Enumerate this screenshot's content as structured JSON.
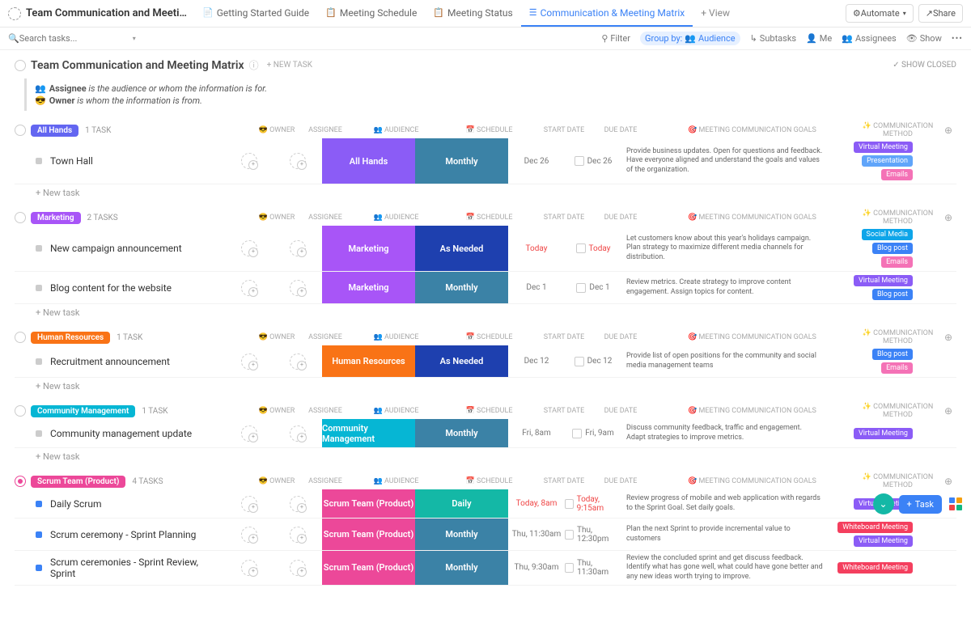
{
  "topbar": {
    "title": "Team Communication and Meeting Ma...",
    "tabs": [
      {
        "label": "Getting Started Guide",
        "icon": "📄"
      },
      {
        "label": "Meeting Schedule",
        "icon": "📋"
      },
      {
        "label": "Meeting Status",
        "icon": "📋"
      },
      {
        "label": "Communication & Meeting Matrix",
        "icon": "☰",
        "active": true
      }
    ],
    "add_view": "+ View",
    "automate": "Automate",
    "share": "Share"
  },
  "toolbar": {
    "search_placeholder": "Search tasks...",
    "filter": "Filter",
    "group_by": "Group by:",
    "group_by_value": "Audience",
    "subtasks": "Subtasks",
    "me": "Me",
    "assignees": "Assignees",
    "show": "Show"
  },
  "pagehead": {
    "title": "Team Communication and Meeting Matrix",
    "new_task": "+ NEW TASK",
    "show_closed": "✓ SHOW CLOSED"
  },
  "infobox": {
    "line1_bold": "Assignee",
    "line1_rest": "is the audience or whom the information is for.",
    "line2_bold": "Owner",
    "line2_rest": "is whom the information is from."
  },
  "column_headers": {
    "owner": "OWNER",
    "assignee": "ASSIGNEE",
    "audience": "AUDIENCE",
    "schedule": "SCHEDULE",
    "start": "START DATE",
    "due": "DUE DATE",
    "goals": "MEETING COMMUNICATION GOALS",
    "method": "COMMUNICATION METHOD"
  },
  "new_task_label": "+ New task",
  "colors": {
    "audience_allhands": "#8b5cf6",
    "audience_marketing": "#a855f7",
    "audience_hr": "#f97316",
    "audience_cm": "#06b6d4",
    "audience_scrum": "#ec4899",
    "schedule_monthly": "#3b82a6",
    "schedule_asneeded": "#1e40af",
    "schedule_daily": "#14b8a6",
    "tag_virtual": "#8b5cf6",
    "tag_presentation": "#60a5fa",
    "tag_emails": "#f472b6",
    "tag_social": "#0ea5e9",
    "tag_blogpost": "#3b82f6",
    "tag_whiteboard": "#f43f5e",
    "pill_allhands": "#6366f1",
    "pill_marketing": "#a855f7",
    "pill_hr": "#f97316",
    "pill_cm": "#06b6d4",
    "pill_scrum": "#ec4899"
  },
  "groups": [
    {
      "name": "All Hands",
      "pill_color": "pill_allhands",
      "count": "1 TASK",
      "tasks": [
        {
          "name": "Town Hall",
          "audience": "All Hands",
          "aud_color": "audience_allhands",
          "schedule": "Monthly",
          "sched_color": "schedule_monthly",
          "start": "Dec 26",
          "due": "Dec 26",
          "goals": "Provide business updates. Open for questions and feedback. Have everyone aligned and understand the goals and values of the organization.",
          "methods": [
            {
              "t": "Virtual Meeting",
              "c": "tag_virtual"
            },
            {
              "t": "Presentation",
              "c": "tag_presentation"
            },
            {
              "t": "Emails",
              "c": "tag_emails"
            }
          ]
        }
      ]
    },
    {
      "name": "Marketing",
      "pill_color": "pill_marketing",
      "count": "2 TASKS",
      "tasks": [
        {
          "name": "New campaign announcement",
          "audience": "Marketing",
          "aud_color": "audience_marketing",
          "schedule": "As Needed",
          "sched_color": "schedule_asneeded",
          "start": "Today",
          "start_red": true,
          "due": "Today",
          "due_red": true,
          "goals": "Let customers know about this year's holidays campaign. Plan strategy to maximize different media channels for distribution.",
          "methods": [
            {
              "t": "Social Media",
              "c": "tag_social"
            },
            {
              "t": "Blog post",
              "c": "tag_blogpost"
            },
            {
              "t": "Emails",
              "c": "tag_emails"
            }
          ]
        },
        {
          "name": "Blog content for the website",
          "audience": "Marketing",
          "aud_color": "audience_marketing",
          "schedule": "Monthly",
          "sched_color": "schedule_monthly",
          "start": "Dec 1",
          "due": "Dec 1",
          "goals": "Review metrics. Create strategy to improve content engagement. Assign topics for content.",
          "methods": [
            {
              "t": "Virtual Meeting",
              "c": "tag_virtual"
            },
            {
              "t": "Blog post",
              "c": "tag_blogpost"
            }
          ]
        }
      ]
    },
    {
      "name": "Human Resources",
      "pill_color": "pill_hr",
      "count": "1 TASK",
      "tasks": [
        {
          "name": "Recruitment announcement",
          "audience": "Human Resources",
          "aud_color": "audience_hr",
          "schedule": "As Needed",
          "sched_color": "schedule_asneeded",
          "start": "Dec 12",
          "due": "Dec 12",
          "goals": "Provide list of open positions for the community and social media management teams",
          "methods": [
            {
              "t": "Blog post",
              "c": "tag_blogpost"
            },
            {
              "t": "Emails",
              "c": "tag_emails"
            }
          ]
        }
      ]
    },
    {
      "name": "Community Management",
      "pill_color": "pill_cm",
      "count": "1 TASK",
      "tasks": [
        {
          "name": "Community management update",
          "audience": "Community Management",
          "aud_color": "audience_cm",
          "schedule": "Monthly",
          "sched_color": "schedule_monthly",
          "start": "Fri, 8am",
          "due": "Fri, 9am",
          "goals": "Discuss community feedback, traffic and engagement. Adapt strategies to improve metrics.",
          "methods": [
            {
              "t": "Virtual Meeting",
              "c": "tag_virtual"
            }
          ]
        }
      ]
    },
    {
      "name": "Scrum Team (Product)",
      "pill_color": "pill_scrum",
      "count": "4 TASKS",
      "pink_toggle": true,
      "tasks": [
        {
          "name": "Daily Scrum",
          "sq": "blue",
          "audience": "Scrum Team (Product)",
          "aud_color": "audience_scrum",
          "schedule": "Daily",
          "sched_color": "schedule_daily",
          "start": "Today, 8am",
          "start_red": true,
          "due": "Today, 9:15am",
          "due_red": true,
          "goals": "Review progress of mobile and web application with regards to the Sprint Goal. Set daily goals.",
          "methods": [
            {
              "t": "Virtual Meeting",
              "c": "tag_virtual"
            }
          ]
        },
        {
          "name": "Scrum ceremony - Sprint Planning",
          "sq": "blue",
          "audience": "Scrum Team (Product)",
          "aud_color": "audience_scrum",
          "schedule": "Monthly",
          "sched_color": "schedule_monthly",
          "start": "Thu, 11:30am",
          "due": "Thu, 12:30pm",
          "goals": "Plan the next Sprint to provide incremental value to customers",
          "methods": [
            {
              "t": "Whiteboard Meeting",
              "c": "tag_whiteboard"
            },
            {
              "t": "Virtual Meeting",
              "c": "tag_virtual"
            }
          ]
        },
        {
          "name": "Scrum ceremonies - Sprint Review, Sprint",
          "sq": "blue",
          "audience": "Scrum Team (Product)",
          "aud_color": "audience_scrum",
          "schedule": "Monthly",
          "sched_color": "schedule_monthly",
          "start": "Thu, 9:30am",
          "due": "Thu, 11:30am",
          "goals": "Review the concluded sprint and get discuss feedback. Identify what has gone well, what could have gone better and any new ideas worth trying to improve.",
          "methods": [
            {
              "t": "Whiteboard Meeting",
              "c": "tag_whiteboard"
            }
          ]
        }
      ],
      "no_newtask": true
    }
  ],
  "floaters": {
    "task_btn": "Task"
  }
}
